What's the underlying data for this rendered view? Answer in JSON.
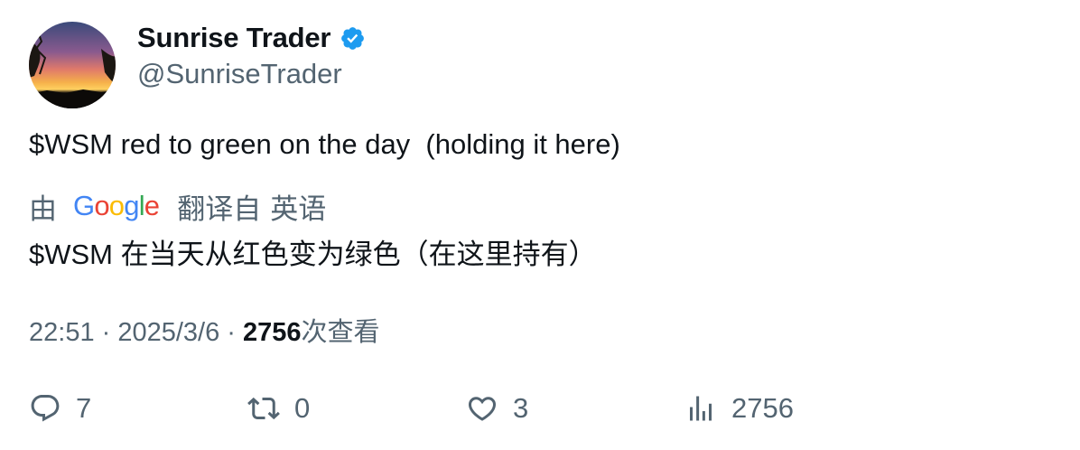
{
  "author": {
    "display_name": "Sunrise Trader",
    "handle": "@SunriseTrader",
    "verified": true
  },
  "tweet": {
    "text": "$WSM red to green on the day  (holding it here)"
  },
  "translation": {
    "by_label": "由",
    "provider": "Google",
    "translated_from_label": "翻译自",
    "source_language": "英语",
    "text": "$WSM 在当天从红色变为绿色（在这里持有）"
  },
  "meta": {
    "time": "22:51",
    "separator": " · ",
    "date": "2025/3/6",
    "views_count": "2756",
    "views_label": "次查看"
  },
  "actions": {
    "replies": "7",
    "retweets": "0",
    "likes": "3",
    "views": "2756"
  },
  "colors": {
    "verified_badge": "#1d9bf0",
    "secondary_text": "#536471",
    "primary_text": "#0f1419"
  }
}
